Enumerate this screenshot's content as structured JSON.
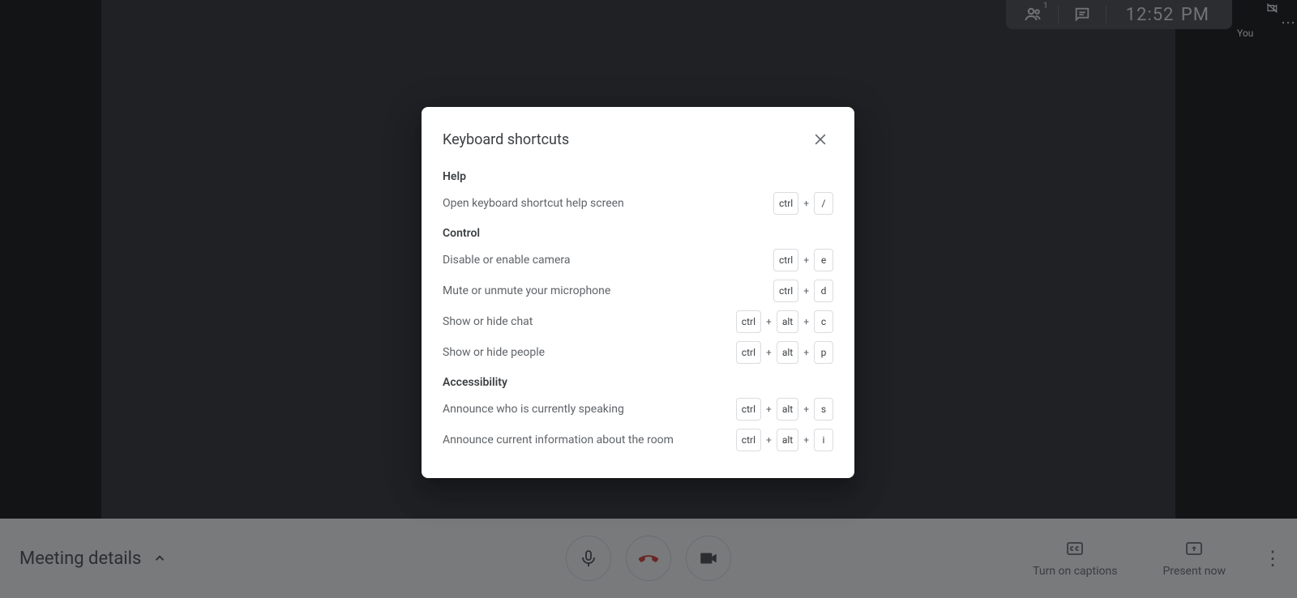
{
  "top_bar": {
    "people_count": "1",
    "clock": "12:52 PM"
  },
  "self_tile": {
    "label": "You"
  },
  "bottom_bar": {
    "meeting_details_label": "Meeting details",
    "captions_label": "Turn on captions",
    "present_label": "Present now"
  },
  "dialog": {
    "title": "Keyboard shortcuts",
    "sections": [
      {
        "heading": "Help",
        "rows": [
          {
            "label": "Open keyboard shortcut help screen",
            "keys": [
              "ctrl",
              "/"
            ]
          }
        ]
      },
      {
        "heading": "Control",
        "rows": [
          {
            "label": "Disable or enable camera",
            "keys": [
              "ctrl",
              "e"
            ]
          },
          {
            "label": "Mute or unmute your microphone",
            "keys": [
              "ctrl",
              "d"
            ]
          },
          {
            "label": "Show or hide chat",
            "keys": [
              "ctrl",
              "alt",
              "c"
            ]
          },
          {
            "label": "Show or hide people",
            "keys": [
              "ctrl",
              "alt",
              "p"
            ]
          }
        ]
      },
      {
        "heading": "Accessibility",
        "rows": [
          {
            "label": "Announce who is currently speaking",
            "keys": [
              "ctrl",
              "alt",
              "s"
            ]
          },
          {
            "label": "Announce current information about the room",
            "keys": [
              "ctrl",
              "alt",
              "i"
            ]
          }
        ]
      }
    ]
  }
}
